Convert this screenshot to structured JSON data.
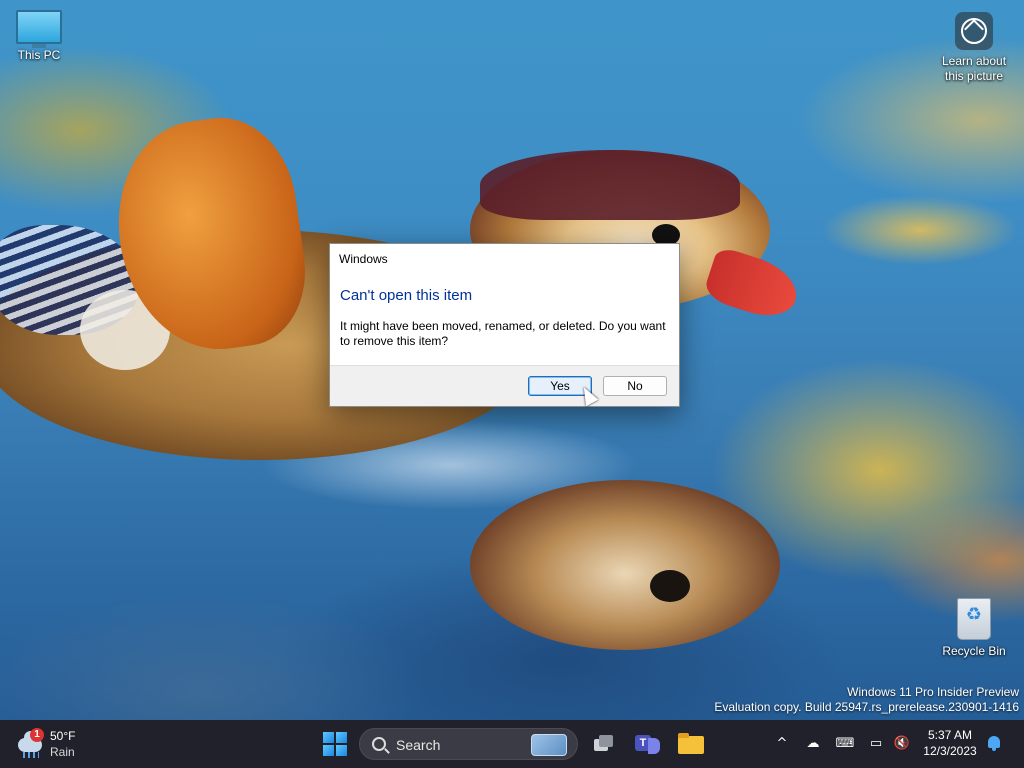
{
  "desktop": {
    "icons": {
      "this_pc": "This PC",
      "learn": "Learn about this picture",
      "recycle_bin": "Recycle Bin"
    },
    "watermark": {
      "line1": "Windows 11 Pro Insider Preview",
      "line2": "Evaluation copy. Build 25947.rs_prerelease.230901-1416"
    }
  },
  "dialog": {
    "title": "Windows",
    "heading": "Can't open this item",
    "message": "It might have been moved, renamed, or deleted. Do you want to remove this item?",
    "buttons": {
      "yes": "Yes",
      "no": "No"
    },
    "heading_color": "#003399"
  },
  "taskbar": {
    "weather": {
      "badge": "1",
      "temperature": "50°F",
      "condition": "Rain"
    },
    "search": {
      "label": "Search"
    },
    "apps": [
      "task-view",
      "teams",
      "file-explorer"
    ],
    "tray": {
      "icons": [
        "chevron-up-icon",
        "onedrive-icon",
        "keyboard-icon",
        "network-icon",
        "volume-muted-icon"
      ],
      "chevron": "^",
      "keyboard": "⌨",
      "network": "▭",
      "volume": "🔇"
    },
    "clock": {
      "time": "5:37 AM",
      "date": "12/3/2023"
    }
  }
}
